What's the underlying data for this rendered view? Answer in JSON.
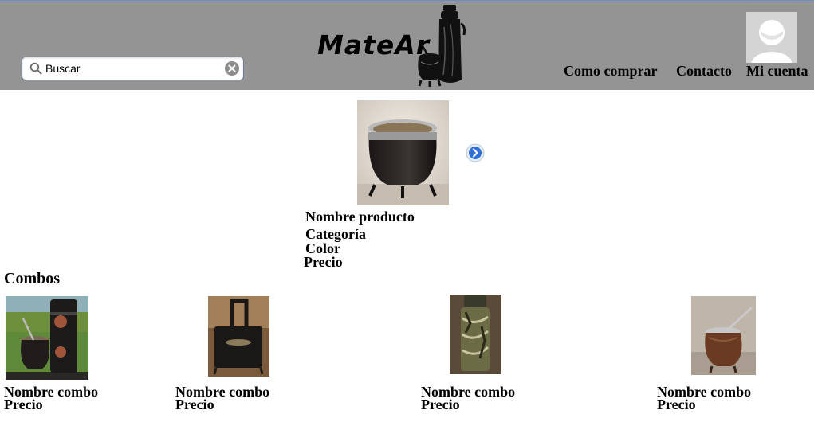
{
  "header": {
    "background": "#949494",
    "search": {
      "value": "",
      "placeholder": "Buscar",
      "icon": "search-icon",
      "clear_icon": "clear-icon"
    },
    "logo": {
      "text": "MateAr",
      "icon": "thermos-and-mate-icon"
    },
    "nav": [
      {
        "label": "Como comprar"
      },
      {
        "label": "Contacto"
      },
      {
        "label": "Mi cuenta"
      }
    ],
    "avatar_icon": "user-avatar-icon"
  },
  "featured": {
    "image": "mate-gourd-photo",
    "name": "Nombre producto",
    "category": "Categoría",
    "color": "Color",
    "price": "Precio",
    "next_icon": "chevron-right-circle-icon"
  },
  "combos": {
    "title": "Combos",
    "items": [
      {
        "image": "mate-and-thermos-photo",
        "name": "Nombre combo",
        "price": "Precio"
      },
      {
        "image": "mate-in-holder-photo",
        "name": "Nombre combo",
        "price": "Precio"
      },
      {
        "image": "camo-thermos-photo",
        "name": "Nombre combo",
        "price": "Precio"
      },
      {
        "image": "wooden-mate-photo",
        "name": "Nombre combo",
        "price": "Precio"
      }
    ]
  }
}
